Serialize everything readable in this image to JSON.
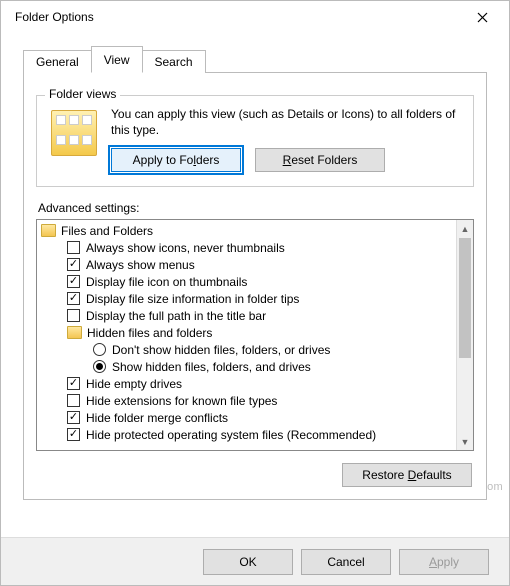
{
  "window": {
    "title": "Folder Options"
  },
  "tabs": {
    "general": "General",
    "view": "View",
    "search": "Search",
    "active": "view"
  },
  "folderViews": {
    "legend": "Folder views",
    "text": "You can apply this view (such as Details or Icons) to all folders of this type.",
    "apply_btn_pre": "Apply to Fo",
    "apply_btn_u": "l",
    "apply_btn_post": "ders",
    "reset_btn_u": "R",
    "reset_btn_post": "eset Folders"
  },
  "advanced": {
    "label": "Advanced settings:",
    "root": "Files and Folders",
    "items": [
      {
        "text": "Always show icons, never thumbnails",
        "checked": false
      },
      {
        "text": "Always show menus",
        "checked": true
      },
      {
        "text": "Display file icon on thumbnails",
        "checked": true
      },
      {
        "text": "Display file size information in folder tips",
        "checked": true
      },
      {
        "text": "Display the full path in the title bar",
        "checked": false
      }
    ],
    "hidden_folder": "Hidden files and folders",
    "radio1": "Don't show hidden files, folders, or drives",
    "radio2": "Show hidden files, folders, and drives",
    "radio_sel": 2,
    "items2": [
      {
        "text": "Hide empty drives",
        "checked": true
      },
      {
        "text": "Hide extensions for known file types",
        "checked": false
      },
      {
        "text": "Hide folder merge conflicts",
        "checked": true
      },
      {
        "text": "Hide protected operating system files (Recommended)",
        "checked": true
      }
    ],
    "restore_pre": "Restore ",
    "restore_u": "D",
    "restore_post": "efaults"
  },
  "footer": {
    "ok": "OK",
    "cancel": "Cancel",
    "apply_u": "A",
    "apply_post": "pply"
  },
  "watermark": "wsxdn.com"
}
